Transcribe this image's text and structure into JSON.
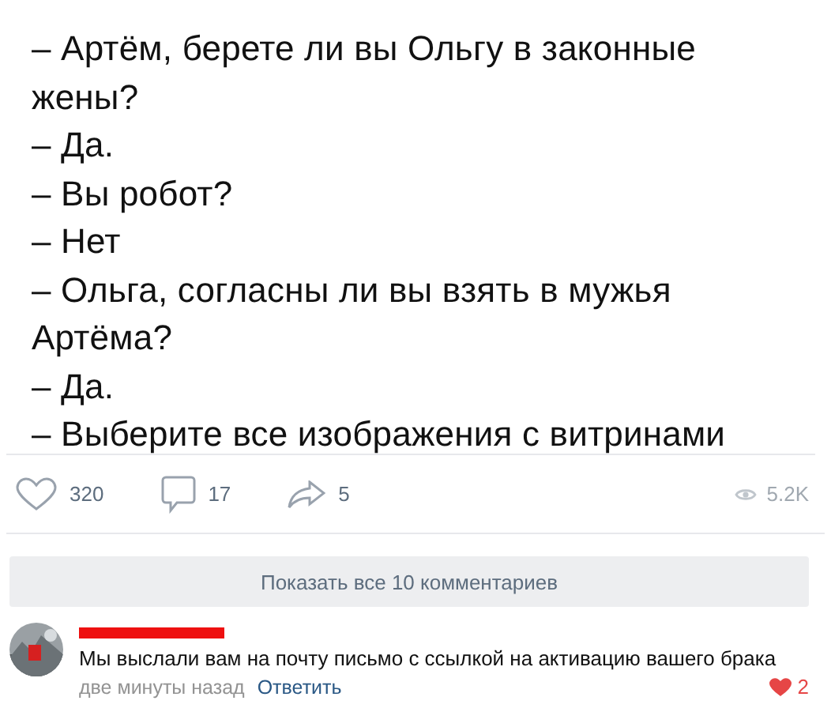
{
  "post": {
    "lines": [
      "– Артём, берете ли вы Ольгу в законные",
      "жены?",
      "– Да.",
      "– Вы робот?",
      "– Нет",
      "– Ольга, согласны ли вы взять в мужья",
      "Артёма?",
      "– Да.",
      "– Выберите все изображения с витринами"
    ]
  },
  "actions": {
    "likes": "320",
    "comments": "17",
    "shares": "5",
    "views": "5.2K"
  },
  "show_comments_button": "Показать все 10 комментариев",
  "comment": {
    "author_redacted": true,
    "text": "Мы выслали вам на почту письмо с ссылкой на активацию вашего брака",
    "time": "две минуты назад",
    "reply": "Ответить",
    "likes": "2",
    "liked": true
  }
}
